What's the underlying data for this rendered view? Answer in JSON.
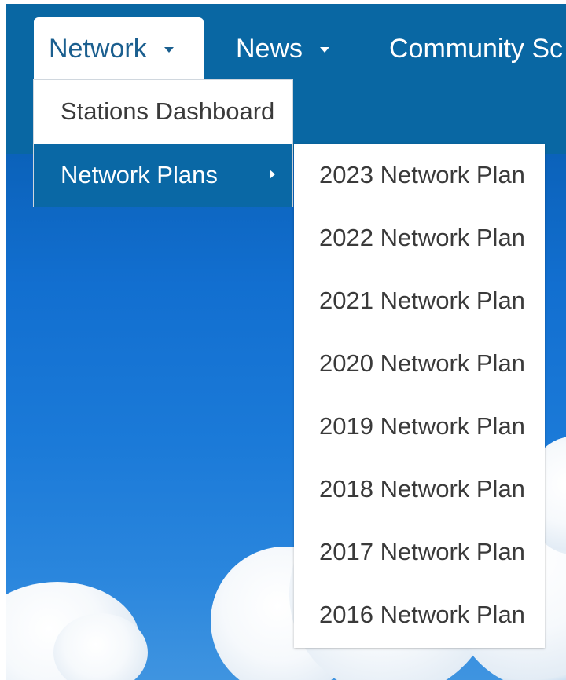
{
  "nav": {
    "network_label": "Network",
    "news_label": "News",
    "community_label": "Community Sc"
  },
  "network_menu": {
    "items": [
      {
        "label": "Stations Dashboard"
      },
      {
        "label": "Network Plans"
      }
    ]
  },
  "network_plans_submenu": {
    "items": [
      {
        "label": "2023 Network Plan"
      },
      {
        "label": "2022 Network Plan"
      },
      {
        "label": "2021 Network Plan"
      },
      {
        "label": "2020 Network Plan"
      },
      {
        "label": "2019 Network Plan"
      },
      {
        "label": "2018 Network Plan"
      },
      {
        "label": "2017 Network Plan"
      },
      {
        "label": "2016 Network Plan"
      }
    ]
  },
  "colors": {
    "navbar": "#0967a3",
    "active_item_bg": "#0a68a5",
    "active_tab_text": "#1b5f8f",
    "menu_text": "#3a3a3a"
  }
}
